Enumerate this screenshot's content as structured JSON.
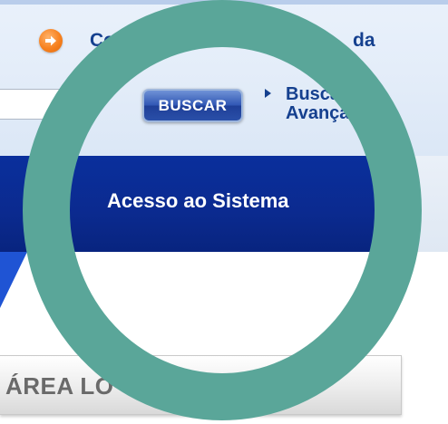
{
  "header": {
    "top_link_left": "Co",
    "top_link_right": "da",
    "icon": "orange-arrow-icon"
  },
  "search": {
    "value": "",
    "placeholder": "",
    "button_label": "BUSCAR",
    "advanced_line1": "Busca",
    "advanced_line2": "Avança"
  },
  "banner": {
    "title": "Acesso ao Sistema"
  },
  "area_tab": {
    "label": "ÁREA LO"
  },
  "colors": {
    "header_bg": "#e4edf9",
    "banner_bg": "#0b2a8f",
    "link": "#15408f",
    "ring": "#5aa699",
    "icon_orange": "#f7811f"
  }
}
